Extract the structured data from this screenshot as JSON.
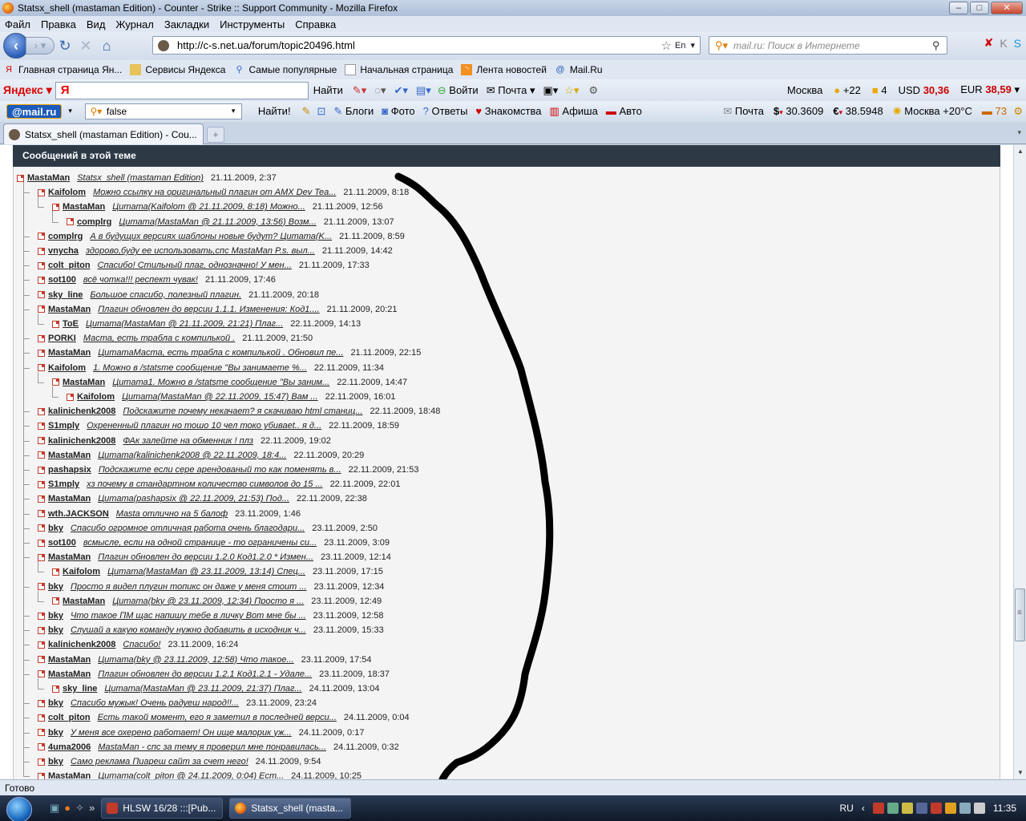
{
  "window": {
    "title": "Statsx_shell (mastaman Edition) - Counter - Strike :: Support Community - Mozilla Firefox",
    "minimize": "‒",
    "maximize": "□",
    "close": "✕"
  },
  "menu": [
    "Файл",
    "Правка",
    "Вид",
    "Журнал",
    "Закладки",
    "Инструменты",
    "Справка"
  ],
  "nav": {
    "url": "http://c-s.net.ua/forum/topic20496.html",
    "lang": "En",
    "search_placeholder": "mail.ru: Поиск в Интернете"
  },
  "bookmarks": [
    "Главная страница Ян...",
    "Сервисы Яндекса",
    "Самые популярные",
    "Начальная страница",
    "Лента новостей",
    "Mail.Ru"
  ],
  "yandex": {
    "logo": "Яндекс",
    "find": "Найти",
    "login": "Войти",
    "mail": "Почта",
    "city": "Москва",
    "weather": "+22",
    "count": "4",
    "usd_label": "USD",
    "usd": "30,36",
    "eur_label": "EUR",
    "eur": "38,59"
  },
  "mailru": {
    "logo": "@mail.ru",
    "search_value": "false",
    "find": "Найти!",
    "links": [
      "Блоги",
      "Фото",
      "Ответы",
      "Знакомства",
      "Афиша",
      "Авто"
    ],
    "mail": "Почта",
    "usd": "30.3609",
    "eur": "38.5948",
    "weather": "Москва +20°C",
    "traffic": "73"
  },
  "tab": {
    "title": "Statsx_shell (mastaman Edition) - Cou..."
  },
  "thread": {
    "header": "Сообщений в этой теме",
    "posts": [
      {
        "level": 0,
        "author": "MastaMan",
        "subject": "Statsx_shell (mastaman Edition)",
        "date": "21.11.2009, 2:37"
      },
      {
        "level": 1,
        "author": "Kaifolom",
        "subject": "Можно ссылку на оригинальный плагин от AMX Dev Tea...",
        "date": "21.11.2009, 8:18"
      },
      {
        "level": 2,
        "author": "MastaMan",
        "subject": "Цитата(Kaifolom @ 21.11.2009, 8:18) Можно...",
        "date": "21.11.2009, 12:56"
      },
      {
        "level": 3,
        "author": "complrg",
        "subject": "Цитата(MastaMan @ 21.11.2009, 13:56) Возм...",
        "date": "21.11.2009, 13:07"
      },
      {
        "level": 1,
        "author": "complrg",
        "subject": "А в будущих версиях шаблоны новые будут? Цитата(K...",
        "date": "21.11.2009, 8:59"
      },
      {
        "level": 1,
        "author": "vnycha",
        "subject": "здорово,буду ее использовать,спс MastaMan P.s. выл...",
        "date": "21.11.2009, 14:42"
      },
      {
        "level": 1,
        "author": "colt_piton",
        "subject": "Спасибо! Стильный плаг, однозначно! У мен...",
        "date": "21.11.2009, 17:33"
      },
      {
        "level": 1,
        "author": "sot100",
        "subject": "всё чотка!!! респект чувак!",
        "date": "21.11.2009, 17:46"
      },
      {
        "level": 1,
        "author": "sky_line",
        "subject": "Большое спасибо, полезный плагин.",
        "date": "21.11.2009, 20:18"
      },
      {
        "level": 1,
        "author": "MastaMan",
        "subject": "Плагин обновлен до версии 1.1.1. Изменения: Код1....",
        "date": "21.11.2009, 20:21"
      },
      {
        "level": 2,
        "author": "ToE",
        "subject": "Цитата(MastaMan @ 21.11.2009, 21:21) Плаг...",
        "date": "22.11.2009, 14:13"
      },
      {
        "level": 1,
        "author": "PORKI",
        "subject": "Маста, есть трабла с компилькой .",
        "date": "21.11.2009, 21:50"
      },
      {
        "level": 1,
        "author": "MastaMan",
        "subject": "ЦитатаМаста, есть трабла с компилькой . Обновил пе...",
        "date": "21.11.2009, 22:15"
      },
      {
        "level": 1,
        "author": "Kaifolom",
        "subject": "1. Можно в /statsme сообщение \"Вы занимаете %...",
        "date": "22.11.2009, 11:34"
      },
      {
        "level": 2,
        "author": "MastaMan",
        "subject": "Цитата1. Можно в /statsme сообщение \"Вы заним...",
        "date": "22.11.2009, 14:47"
      },
      {
        "level": 3,
        "author": "Kaifolom",
        "subject": "Цитата(MastaMan @ 22.11.2009, 15:47) Вам ...",
        "date": "22.11.2009, 16:01"
      },
      {
        "level": 1,
        "author": "kalinichenk2008",
        "subject": "Подскажите почему некачает? я скачиваю html станиц...",
        "date": "22.11.2009, 18:48"
      },
      {
        "level": 1,
        "author": "S1mply",
        "subject": "Охрененный плагин но тошо 10 чел токо убиваеt.. я д...",
        "date": "22.11.2009, 18:59"
      },
      {
        "level": 1,
        "author": "kalinichenk2008",
        "subject": "ФАк залейте на обменник ! плз",
        "date": "22.11.2009, 19:02"
      },
      {
        "level": 1,
        "author": "MastaMan",
        "subject": "Цитата(kalinichenk2008 @ 22.11.2009, 18:4...",
        "date": "22.11.2009, 20:29"
      },
      {
        "level": 1,
        "author": "pashapsix",
        "subject": "Подскажите если сере арендованый то как поменять в...",
        "date": "22.11.2009, 21:53"
      },
      {
        "level": 1,
        "author": "S1mply",
        "subject": "хз почему в стандартном количество символов до 15 ...",
        "date": "22.11.2009, 22:01"
      },
      {
        "level": 1,
        "author": "MastaMan",
        "subject": "Цитата(pashapsix @ 22.11.2009, 21:53) Под...",
        "date": "22.11.2009, 22:38"
      },
      {
        "level": 1,
        "author": "wth.JACKSON",
        "subject": "Masta отлично на 5 балоф",
        "date": "23.11.2009, 1:46"
      },
      {
        "level": 1,
        "author": "bky",
        "subject": "Спасибо огромное отличная работа очень благодари...",
        "date": "23.11.2009, 2:50"
      },
      {
        "level": 1,
        "author": "sot100",
        "subject": "всмысле, если на одной странице - то ограничены си...",
        "date": "23.11.2009, 3:09"
      },
      {
        "level": 1,
        "author": "MastaMan",
        "subject": "Плагин обновлен до версии 1.2.0 Код1.2.0 * Измен...",
        "date": "23.11.2009, 12:14"
      },
      {
        "level": 2,
        "author": "Kaifolom",
        "subject": "Цитата(MastaMan @ 23.11.2009, 13:14) Спец...",
        "date": "23.11.2009, 17:15"
      },
      {
        "level": 1,
        "author": "bky",
        "subject": "Просто я видел плугин топикс он даже у меня стоит ...",
        "date": "23.11.2009, 12:34"
      },
      {
        "level": 2,
        "author": "MastaMan",
        "subject": "Цитата(bky @ 23.11.2009, 12:34) Просто я ...",
        "date": "23.11.2009, 12:49"
      },
      {
        "level": 1,
        "author": "bky",
        "subject": "Что такое ПМ щас напишу тебе в личку Вот мне бы ...",
        "date": "23.11.2009, 12:58"
      },
      {
        "level": 1,
        "author": "bky",
        "subject": "Слушай а какую команду нужно добавить в исходник ч...",
        "date": "23.11.2009, 15:33"
      },
      {
        "level": 1,
        "author": "kalinichenk2008",
        "subject": "Спасибо!",
        "date": "23.11.2009, 16:24"
      },
      {
        "level": 1,
        "author": "MastaMan",
        "subject": "Цитата(bky @ 23.11.2009, 12:58) Что такое...",
        "date": "23.11.2009, 17:54"
      },
      {
        "level": 1,
        "author": "MastaMan",
        "subject": "Плагин обновлен до версии 1.2.1 Код1.2.1 - Удале...",
        "date": "23.11.2009, 18:37"
      },
      {
        "level": 2,
        "author": "sky_line",
        "subject": "Цитата(MastaMan @ 23.11.2009, 21:37) Плаг...",
        "date": "24.11.2009, 13:04"
      },
      {
        "level": 1,
        "author": "bky",
        "subject": "Спасибо мужык! Очень радуеш народ!!...",
        "date": "23.11.2009, 23:24"
      },
      {
        "level": 1,
        "author": "colt_piton",
        "subject": "Есть такой момент, его я заметил в последней верси...",
        "date": "24.11.2009, 0:04"
      },
      {
        "level": 1,
        "author": "bky",
        "subject": "У меня все охерено работает! Он ище малорик уж...",
        "date": "24.11.2009, 0:17"
      },
      {
        "level": 1,
        "author": "4uma2006",
        "subject": "MastaMan - спс за тему я проверил мне понравилась...",
        "date": "24.11.2009, 0:32"
      },
      {
        "level": 1,
        "author": "bky",
        "subject": "Само реклама Пиареш сайт за счет него!",
        "date": "24.11.2009, 9:54"
      },
      {
        "level": 1,
        "author": "MastaMan",
        "subject": "Цитата(colt_piton @ 24.11.2009, 0:04) Ест...",
        "date": "24.11.2009, 10:25"
      }
    ]
  },
  "status": "Готово",
  "taskbar": {
    "tasks": [
      "HLSW  16/28 :::[Pub...",
      "Statsx_shell (masta..."
    ],
    "lang": "RU",
    "time": "11:35"
  }
}
